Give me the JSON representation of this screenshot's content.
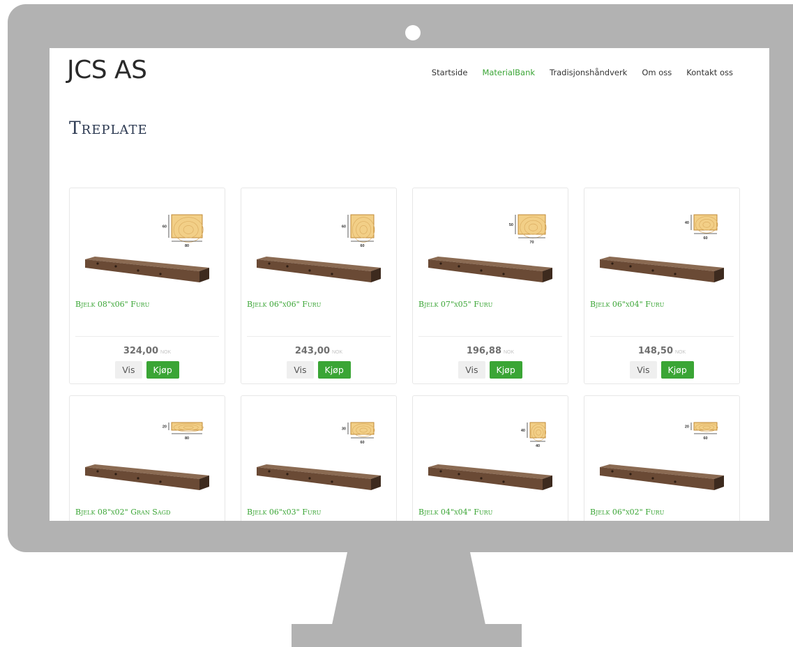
{
  "site": {
    "logo": "JCS AS"
  },
  "nav": {
    "items": [
      {
        "label": "Startside",
        "active": false
      },
      {
        "label": "MaterialBank",
        "active": true
      },
      {
        "label": "Tradisjonshåndverk",
        "active": false
      },
      {
        "label": "Om oss",
        "active": false
      },
      {
        "label": "Kontakt oss",
        "active": false
      }
    ]
  },
  "page": {
    "title": "Treplate"
  },
  "colors": {
    "accent": "#3aa535",
    "title": "#2d3a52",
    "monitor": "#b2b2b2",
    "wood_light": "#f2cf87",
    "beam": "#6a4a35"
  },
  "products": [
    {
      "title": "Bjelk 08\"x06\" Furu",
      "price": "324,00",
      "currency": "NOK",
      "view_label": "Vis",
      "buy_label": "Kjøp",
      "dim_h": "60",
      "dim_w": "80"
    },
    {
      "title": "Bjelk 06\"x06\" Furu",
      "price": "243,00",
      "currency": "NOK",
      "view_label": "Vis",
      "buy_label": "Kjøp",
      "dim_h": "60",
      "dim_w": "60"
    },
    {
      "title": "Bjelk 07\"x05\" Furu",
      "price": "196,88",
      "currency": "NOK",
      "view_label": "Vis",
      "buy_label": "Kjøp",
      "dim_h": "50",
      "dim_w": "70"
    },
    {
      "title": "Bjelk 06\"x04\" Furu",
      "price": "148,50",
      "currency": "NOK",
      "view_label": "Vis",
      "buy_label": "Kjøp",
      "dim_h": "40",
      "dim_w": "60"
    },
    {
      "title": "Bjelk 08\"x02\" Gran Sagd",
      "price": "",
      "currency": "",
      "view_label": "",
      "buy_label": "",
      "dim_h": "20",
      "dim_w": "80"
    },
    {
      "title": "Bjelk 06\"x03\" Furu",
      "price": "",
      "currency": "",
      "view_label": "",
      "buy_label": "",
      "dim_h": "30",
      "dim_w": "60"
    },
    {
      "title": "Bjelk 04\"x04\" Furu",
      "price": "",
      "currency": "",
      "view_label": "",
      "buy_label": "",
      "dim_h": "40",
      "dim_w": "40"
    },
    {
      "title": "Bjelk 06\"x02\" Furu",
      "price": "",
      "currency": "",
      "view_label": "",
      "buy_label": "",
      "dim_h": "20",
      "dim_w": "60"
    }
  ]
}
